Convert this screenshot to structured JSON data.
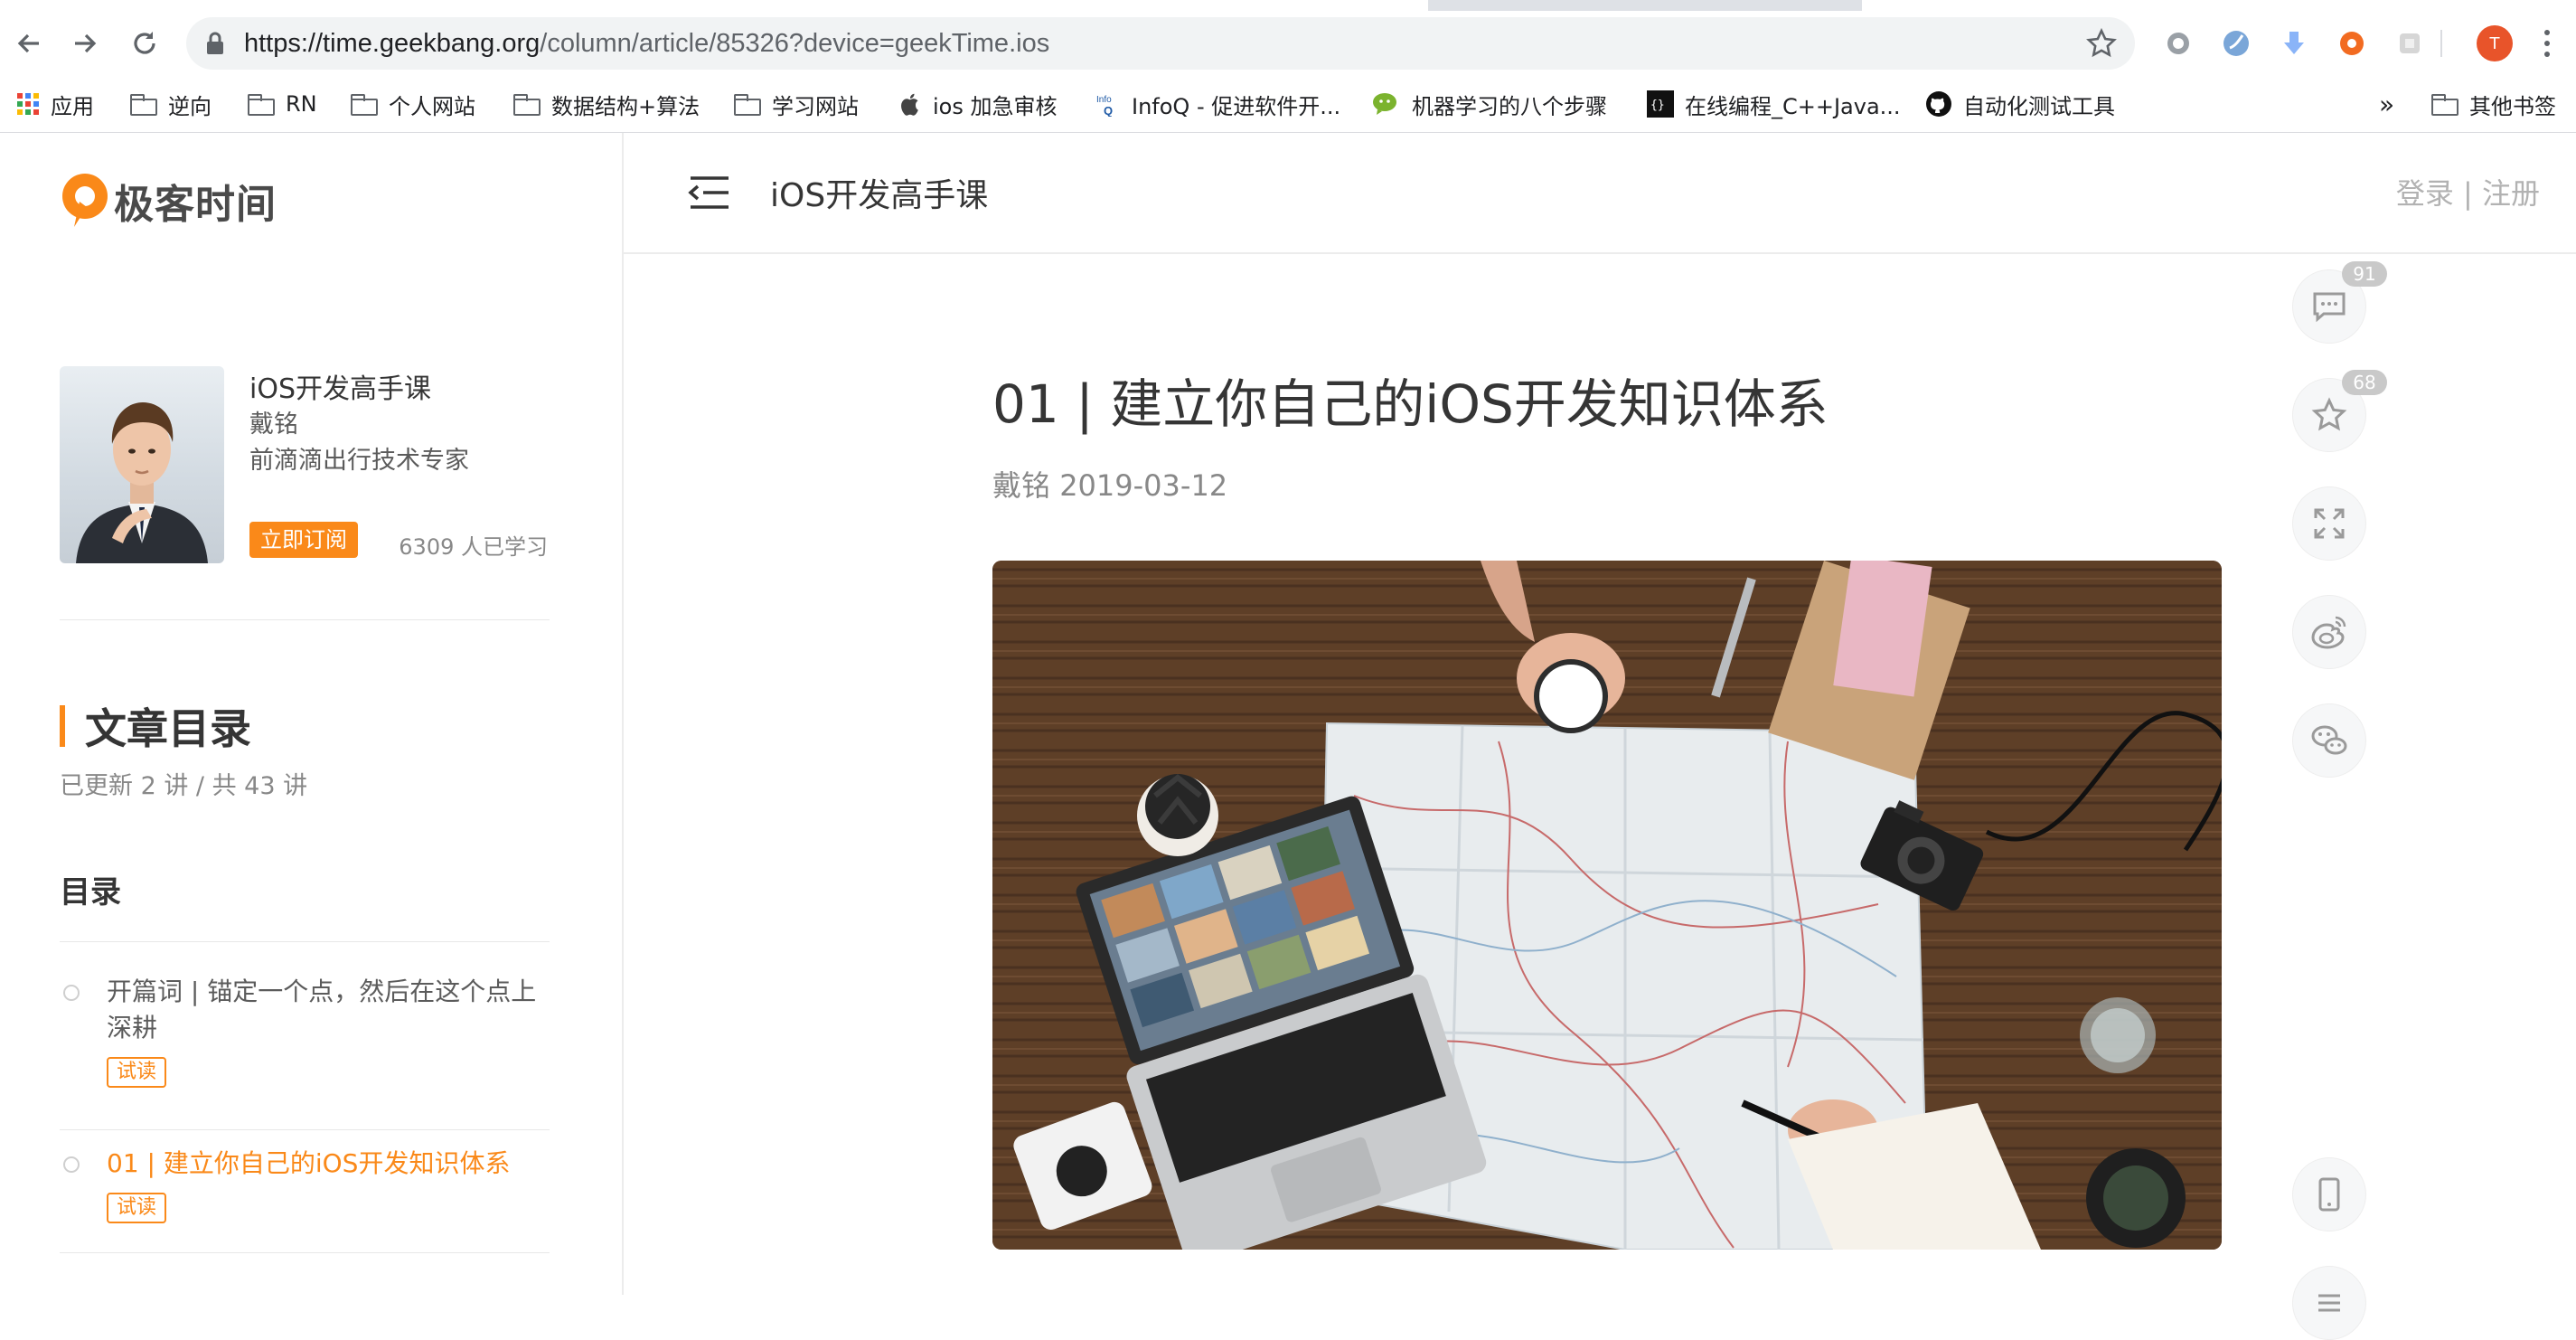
{
  "browser": {
    "url_host": "https://time.geekbang.org",
    "url_path": "/column/article/85326?device=geekTime.ios",
    "profile_initial": "T",
    "bookmarks": [
      {
        "label": "应用",
        "icon": "apps-grid-icon"
      },
      {
        "label": "逆向",
        "icon": "folder-icon"
      },
      {
        "label": "RN",
        "icon": "folder-icon"
      },
      {
        "label": "个人网站",
        "icon": "folder-icon"
      },
      {
        "label": "数据结构+算法",
        "icon": "folder-icon"
      },
      {
        "label": "学习网站",
        "icon": "folder-icon"
      },
      {
        "label": "ios 加急审核",
        "icon": "apple-icon"
      },
      {
        "label": "InfoQ - 促进软件开...",
        "icon": "infoq-icon"
      },
      {
        "label": "机器学习的八个步骤",
        "icon": "wechat-icon"
      },
      {
        "label": "在线编程_C++Java...",
        "icon": "code-icon"
      },
      {
        "label": "自动化测试工具",
        "icon": "github-icon"
      }
    ],
    "bookmarks_overflow": "»",
    "other_bookmarks": "其他书签"
  },
  "sidebar": {
    "logo_text": "极客时间",
    "course": {
      "name": "iOS开发高手课",
      "author": "戴铭",
      "author_title": "前滴滴出行技术专家",
      "subscribe_label": "立即订阅",
      "learners": "6309 人已学习"
    },
    "toc": {
      "heading": "文章目录",
      "progress": "已更新 2 讲 / 共 43 讲",
      "sub_heading": "目录",
      "items": [
        {
          "title": "开篇词 | 锚定一个点，然后在这个点上深耕",
          "tag": "试读",
          "active": false
        },
        {
          "title": "01 | 建立你自己的iOS开发知识体系",
          "tag": "试读",
          "active": true
        }
      ]
    }
  },
  "topbar": {
    "title": "iOS开发高手课",
    "login": "登录",
    "separator": " | ",
    "register": "注册"
  },
  "article": {
    "title": "01 | 建立你自己的iOS开发知识体系",
    "author": "戴铭",
    "date": "2019-03-12"
  },
  "float_actions": {
    "comments_count": "91",
    "favorites_count": "68"
  },
  "colors": {
    "accent": "#fa8919",
    "text": "#353535",
    "muted": "#888888"
  }
}
